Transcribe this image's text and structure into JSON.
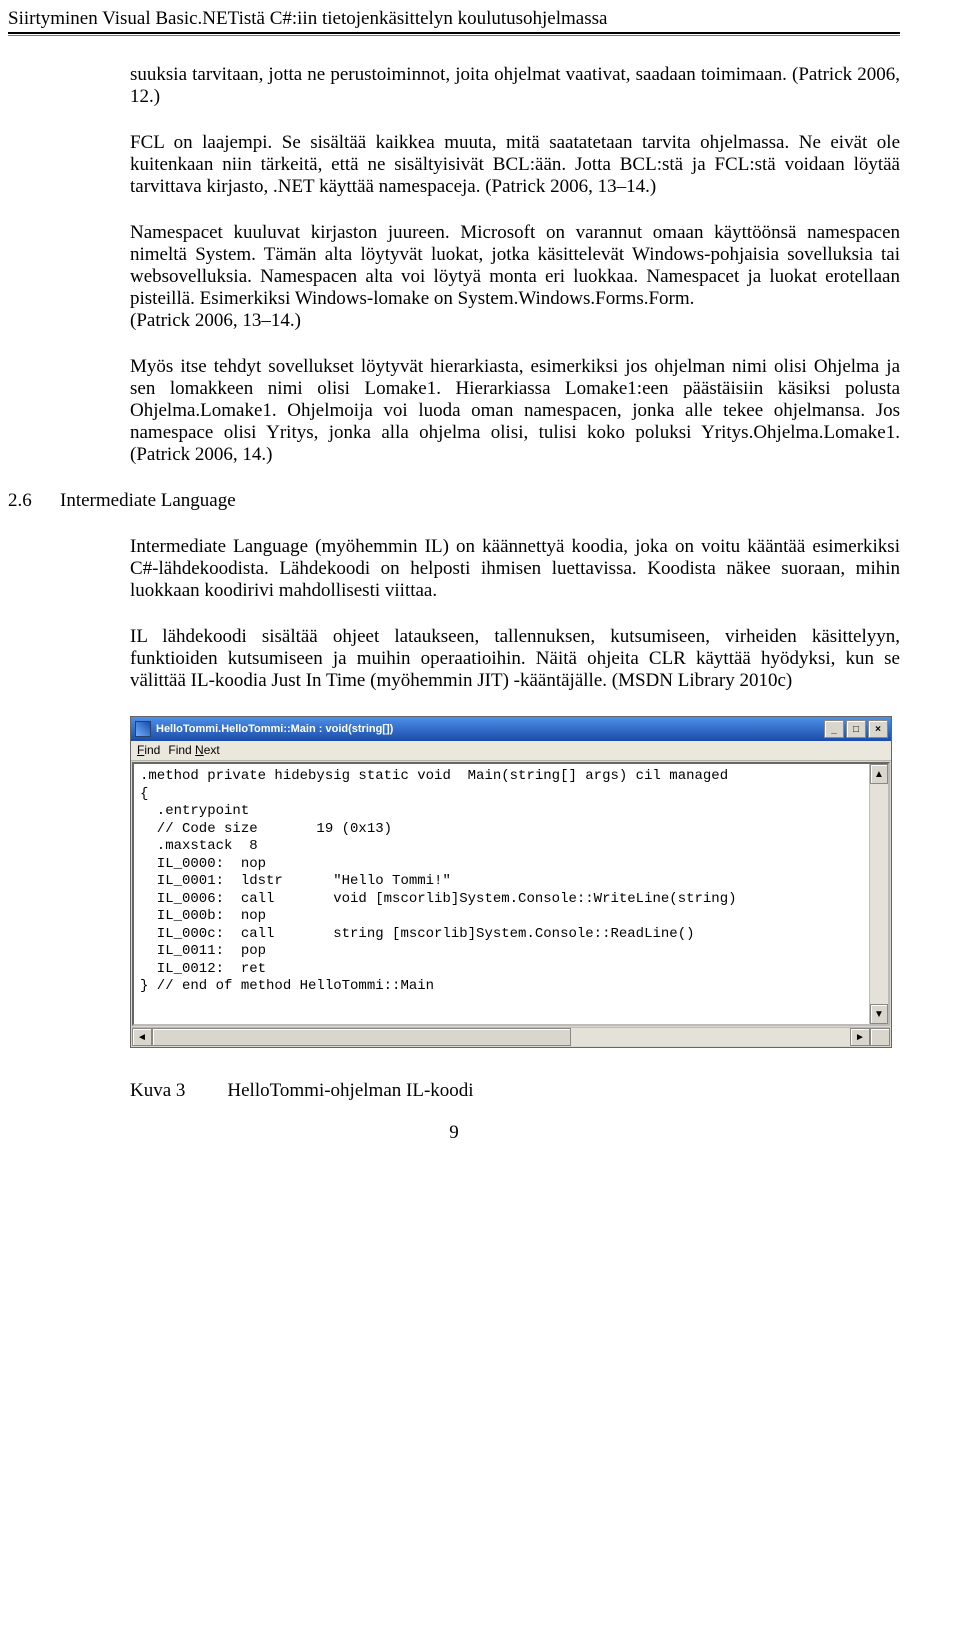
{
  "header": "Siirtyminen Visual Basic.NETistä C#:iin tietojenkäsittelyn koulutusohjelmassa",
  "para1": "suuksia tarvitaan, jotta ne perustoiminnot, joita ohjelmat vaativat, saadaan toimimaan. (Patrick 2006, 12.)",
  "para2": "FCL on laajempi. Se sisältää kaikkea muuta, mitä saatatetaan tarvita ohjelmassa. Ne eivät ole kuitenkaan niin tärkeitä, että ne sisältyisivät BCL:ään. Jotta BCL:stä ja FCL:stä voidaan löytää tarvittava kirjasto, .NET käyttää namespaceja. (Patrick 2006, 13–14.)",
  "para3": "Namespacet kuuluvat kirjaston juureen. Microsoft on varannut omaan käyttöönsä namespacen nimeltä System. Tämän alta löytyvät luokat, jotka käsittelevät Windows-pohjaisia sovelluksia tai websovelluksia. Namespacen alta voi löytyä monta eri luokkaa. Namespacet ja luokat erotellaan pisteillä. Esimerkiksi Windows-lomake on System.Windows.Forms.Form.",
  "para3b": "(Patrick 2006, 13–14.)",
  "para4": "Myös itse tehdyt sovellukset löytyvät hierarkiasta, esimerkiksi jos ohjelman nimi olisi Ohjelma ja sen lomakkeen nimi olisi Lomake1. Hierarkiassa Lomake1:een päästäisiin käsiksi polusta Ohjelma.Lomake1. Ohjelmoija voi luoda oman namespacen, jonka alle tekee ohjelmansa. Jos namespace olisi Yritys, jonka alla ohjelma olisi, tulisi koko poluksi Yritys.Ohjelma.Lomake1. (Patrick 2006, 14.)",
  "section": {
    "num": "2.6",
    "title": "Intermediate Language"
  },
  "para5": "Intermediate Language (myöhemmin IL) on käännettyä koodia, joka on voitu kääntää esimerkiksi C#-lähdekoodista. Lähdekoodi on helposti ihmisen luettavissa. Koodista näkee suoraan, mihin luokkaan koodirivi mahdollisesti viittaa.",
  "para6": "IL lähdekoodi sisältää ohjeet lataukseen, tallennuksen, kutsumiseen, virheiden käsittelyyn, funktioiden kutsumiseen ja muihin operaatioihin. Näitä ohjeita CLR käyttää hyödyksi, kun se välittää IL-koodia Just In Time (myöhemmin JIT) -kääntäjälle. (MSDN Library 2010c)",
  "IL": {
    "title": "HelloTommi.HelloTommi::Main : void(string[])",
    "menu": {
      "find": "Find",
      "findnext": "Find Next"
    },
    "code": ".method private hidebysig static void  Main(string[] args) cil managed\n{\n  .entrypoint\n  // Code size       19 (0x13)\n  .maxstack  8\n  IL_0000:  nop\n  IL_0001:  ldstr      \"Hello Tommi!\"\n  IL_0006:  call       void [mscorlib]System.Console::WriteLine(string)\n  IL_000b:  nop\n  IL_000c:  call       string [mscorlib]System.Console::ReadLine()\n  IL_0011:  pop\n  IL_0012:  ret\n} // end of method HelloTommi::Main"
  },
  "caption": {
    "label": "Kuva 3",
    "text": "HelloTommi-ohjelman IL-koodi"
  },
  "pagenum": "9"
}
